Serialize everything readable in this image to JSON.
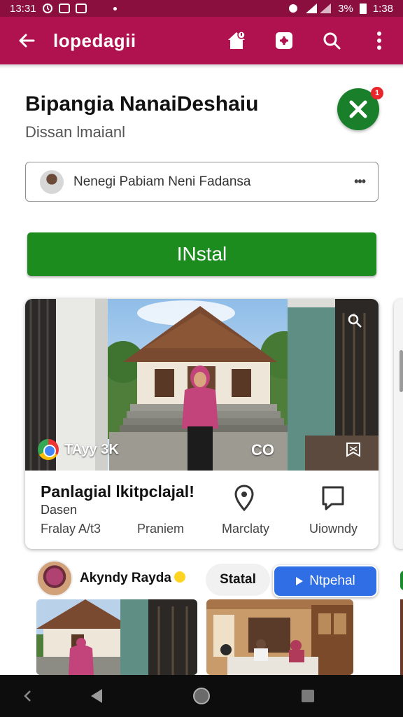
{
  "status_bar": {
    "time_left": "13:31",
    "battery_text": "3%",
    "time_right": "1:38"
  },
  "app_bar": {
    "title": "lopedagii",
    "icons": [
      "back-arrow-icon",
      "home-icon",
      "screenshot-icon",
      "search-icon",
      "more-vert-icon"
    ],
    "background": "#b0124f"
  },
  "app": {
    "name": "Bipangia NanaiDeshaiu",
    "subtitle": "Dissan lmaianl",
    "badge_count": "1"
  },
  "account": {
    "label": "Nenegi Pabiam Neni Fadansa"
  },
  "install_button": {
    "label": "INstal",
    "color": "#1c8c1f"
  },
  "feature_card": {
    "hero": {
      "browser_label": "TAyy 3K",
      "corner_text": "CO"
    },
    "title": "Panlagial lkitpclajal!",
    "subtitle": "Dasen",
    "meta": "Fralay A/t3",
    "actions": [
      {
        "label": "Praniem",
        "icon": "none"
      },
      {
        "label": "Marclaty",
        "icon": "location-pin-icon"
      },
      {
        "label": "Uiowndy",
        "icon": "comment-icon"
      }
    ]
  },
  "author_row": {
    "name": "Akyndy Rayda",
    "status_chip": "Statal",
    "play_chip": "Ntpehal"
  },
  "nav_bar": {
    "buttons": [
      "chevron-left-icon",
      "back-triangle-icon",
      "home-circle-icon",
      "recents-square-icon"
    ]
  }
}
